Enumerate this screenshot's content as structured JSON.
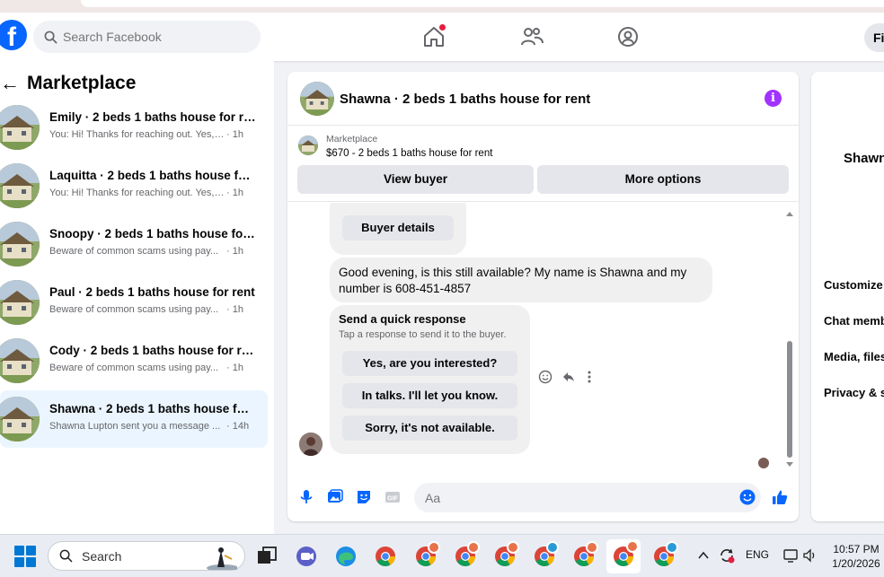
{
  "header": {
    "search_placeholder": "Search Facebook",
    "profile_initial": "Fi"
  },
  "sidebar": {
    "title": "Marketplace",
    "conversations": [
      {
        "name": "Emily · 2 beds 1 baths house for rent",
        "preview": "You: Hi! Thanks for reaching out. Yes, i...",
        "time": "· 1h"
      },
      {
        "name": "Laquitta · 2 beds 1 baths house for...",
        "preview": "You: Hi! Thanks for reaching out. Yes, i...",
        "time": "· 1h"
      },
      {
        "name": "Snoopy · 2 beds 1 baths house for ...",
        "preview": "Beware of common scams using pay...",
        "time": "· 1h"
      },
      {
        "name": "Paul · 2 beds 1 baths house for rent",
        "preview": "Beware of common scams using pay...",
        "time": "· 1h"
      },
      {
        "name": "Cody · 2 beds 1 baths house for rent",
        "preview": "Beware of common scams using pay...",
        "time": "· 1h"
      },
      {
        "name": "Shawna · 2 beds 1 baths house for ...",
        "preview": "Shawna Lupton sent you a message ...",
        "time": "· 14h"
      }
    ]
  },
  "chat": {
    "title": "Shawna · 2 beds 1 baths house for rent",
    "listing_source": "Marketplace",
    "listing_price_title": "$670 - 2 beds 1 baths house for rent",
    "view_buyer": "View buyer",
    "more_options": "More options",
    "buyer_details": "Buyer details",
    "message": "Good evening, is this still available? My name is Shawna and my number is 608-451-4857",
    "quick_title": "Send a quick response",
    "quick_subtitle": "Tap a response to send it to the buyer.",
    "quick_replies": [
      "Yes, are you interested?",
      "In talks. I'll let you know.",
      "Sorry, it's not available."
    ],
    "input_placeholder": "Aa"
  },
  "details_panel": {
    "name": "Shawn",
    "items": [
      "Customize",
      "Chat memb",
      "Media, files",
      "Privacy & s"
    ]
  },
  "taskbar": {
    "search_label": "Search",
    "language": "ENG",
    "time": "10:57 PM",
    "date": "1/20/2026"
  },
  "colors": {
    "facebook_blue": "#0866ff",
    "info_purple": "#a033ff",
    "active_row": "#ebf5ff"
  }
}
